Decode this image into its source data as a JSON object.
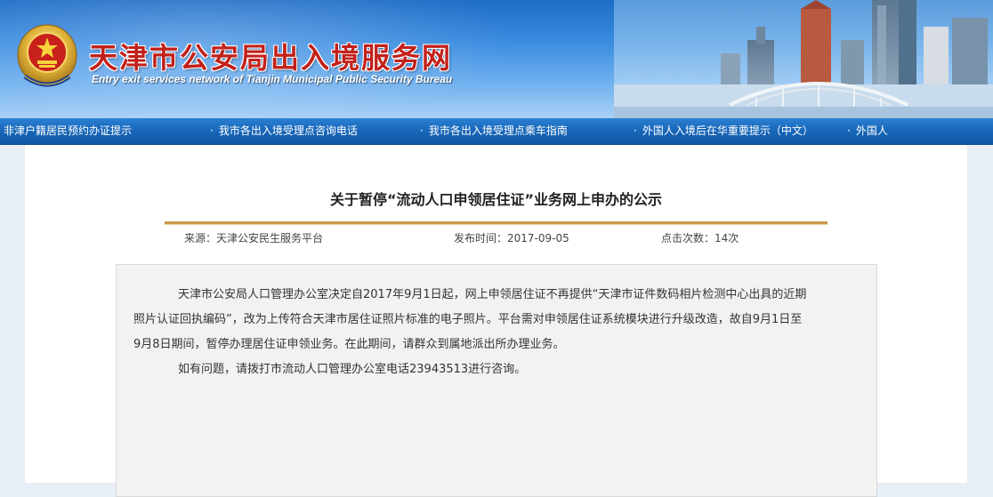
{
  "header": {
    "title": "天津市公安局出入境服务网",
    "subtitle": "Entry exit services network of Tianjin Municipal Public Security Bureau",
    "emblem_icon": "police-emblem-icon"
  },
  "nav": {
    "items": [
      {
        "label": "非津户籍居民预约办证提示"
      },
      {
        "label": "我市各出入境受理点咨询电话"
      },
      {
        "label": "我市各出入境受理点乘车指南"
      },
      {
        "label": "外国人入境后在华重要提示（中文）"
      },
      {
        "label": "外国人"
      }
    ],
    "bullet": "·"
  },
  "article": {
    "title": "关于暂停“流动人口申领居住证”业务网上申办的公示",
    "source": "来源：天津公安民生服务平台",
    "publish_time": "发布时间：2017-09-05",
    "clicks": "点击次数：14次",
    "paragraph_1_line_1": "天津市公安局人口管理办公室决定自2017年9月1日起，网上申领居住证不再提供“天津市证件数码相片检测中心出具的近期",
    "paragraph_1_line_2": "照片认证回执编码”，改为上传符合天津市居住证照片标准的电子照片。平台需对申领居住证系统模块进行升级改造，故自9月1日至",
    "paragraph_1_line_3": "9月8日期间，暂停办理居住证申领业务。在此期间，请群众到属地派出所办理业务。",
    "paragraph_2": "如有问题，请拨打市流动人口管理办公室电话23943513进行咨询。"
  },
  "colors": {
    "title_red": "#c2211a",
    "nav_blue": "#1866b8",
    "rule_gold": "#c99a4a"
  }
}
